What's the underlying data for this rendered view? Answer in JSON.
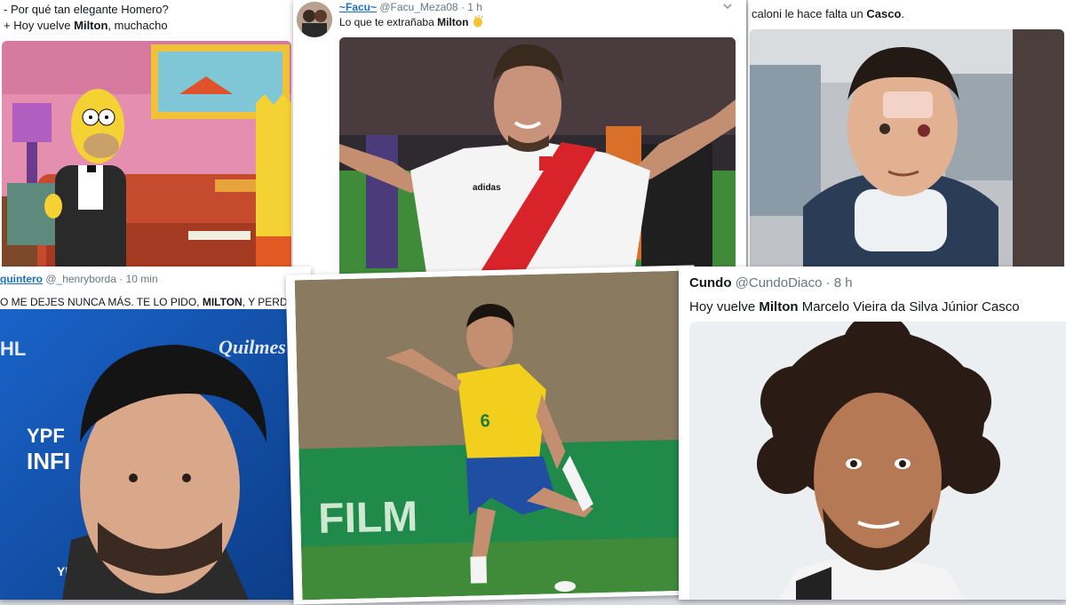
{
  "tweet1": {
    "line1": "- Por qué tan elegante Homero?",
    "line2_pre": "+ Hoy vuelve ",
    "line2_bold": "Milton",
    "line2_post": ", muchacho"
  },
  "tweet2": {
    "name": "~Facu~",
    "handle": "@Facu_Meza08",
    "time": "· 1 h",
    "text_pre": "Lo que te extrañaba ",
    "text_bold": "Milton",
    "emoji_icon": "clapping-hands-icon",
    "menu_icon": "chevron-down-icon",
    "kit_brand": "adidas"
  },
  "tweet3": {
    "text_pre": "caloni le hace falta un ",
    "text_bold": "Casco",
    "text_post": "."
  },
  "tweet4": {
    "name": "quintero",
    "handle": "@_henryborda",
    "time": "· 10 min",
    "text_pre": "O ME DEJES NUNCA MÁS. TE LO PIDO, ",
    "text_bold": "MILTON",
    "text_post": ", Y PERDÓN TODA LA",
    "backdrop_quilmes": "Quilmes",
    "backdrop_ypf": "YPF",
    "backdrop_infi": "INFI",
    "backdrop_hl": "HL"
  },
  "tweet5": {
    "jersey_number": "6",
    "billboard": "FILM"
  },
  "tweet6": {
    "name": "Cundo",
    "handle": "@CundoDiaco",
    "time": "· 8 h",
    "text_pre": "Hoy vuelve ",
    "text_bold": "Milton",
    "text_post": " Marcelo Vieira da Silva Júnior Casco"
  },
  "colors": {
    "river_red": "#d8232a",
    "brazil_yellow": "#f2cf1d",
    "brazil_blue": "#1f4ea3",
    "simpsons_pink": "#e58fb0",
    "pitch_green": "#3f8b3a",
    "link_blue": "#1c6fbf",
    "backdrop_blue": "#1557b8"
  }
}
